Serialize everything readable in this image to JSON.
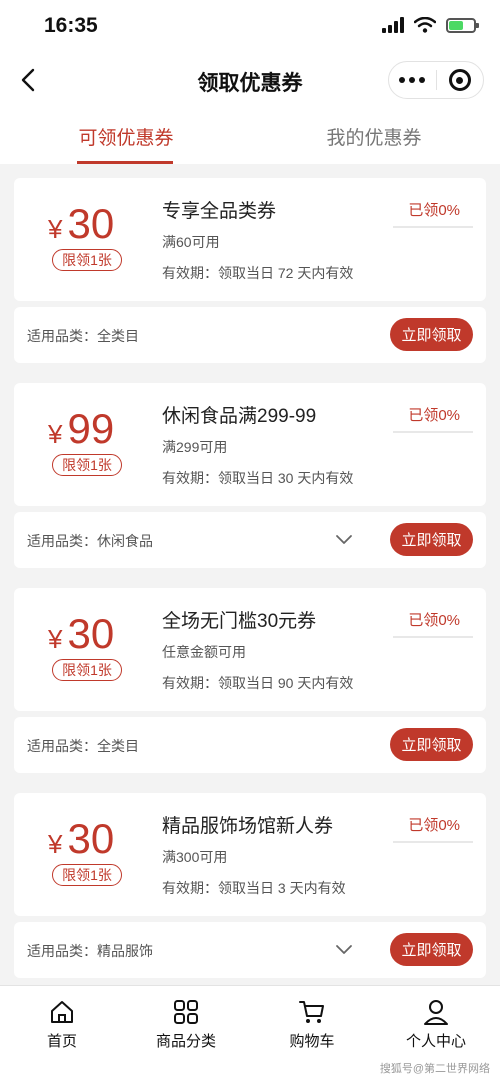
{
  "status_bar": {
    "time": "16:35"
  },
  "nav": {
    "title": "领取优惠券"
  },
  "tabs": [
    {
      "label": "可领优惠券",
      "active": true
    },
    {
      "label": "我的优惠券",
      "active": false
    }
  ],
  "coupons": [
    {
      "currency": "¥",
      "amount": "30",
      "limit": "限领1张",
      "title": "专享全品类券",
      "condition": "满60可用",
      "validity": "有效期：领取当日 72 天内有效",
      "claimed": "已领0%",
      "claimed_fraction": 0,
      "scope": "适用品类：全类目",
      "button": "立即领取",
      "expandable": false
    },
    {
      "currency": "¥",
      "amount": "99",
      "limit": "限领1张",
      "title": "休闲食品满299-99",
      "condition": "满299可用",
      "validity": "有效期：领取当日 30 天内有效",
      "claimed": "已领0%",
      "claimed_fraction": 0,
      "scope": "适用品类：休闲食品",
      "button": "立即领取",
      "expandable": true
    },
    {
      "currency": "¥",
      "amount": "30",
      "limit": "限领1张",
      "title": "全场无门槛30元券",
      "condition": "任意金额可用",
      "validity": "有效期：领取当日 90 天内有效",
      "claimed": "已领0%",
      "claimed_fraction": 0,
      "scope": "适用品类：全类目",
      "button": "立即领取",
      "expandable": false
    },
    {
      "currency": "¥",
      "amount": "30",
      "limit": "限领1张",
      "title": "精品服饰场馆新人券",
      "condition": "满300可用",
      "validity": "有效期：领取当日 3 天内有效",
      "claimed": "已领0%",
      "claimed_fraction": 0,
      "scope": "适用品类：精品服饰",
      "button": "立即领取",
      "expandable": true
    }
  ],
  "tab_bar": [
    {
      "label": "首页",
      "icon": "home-icon"
    },
    {
      "label": "商品分类",
      "icon": "category-grid-icon"
    },
    {
      "label": "购物车",
      "icon": "cart-icon"
    },
    {
      "label": "个人中心",
      "icon": "profile-icon"
    }
  ],
  "watermark": "搜狐号@第二世界网络",
  "colors": {
    "accent": "#c0392b",
    "background": "#f3f3f3",
    "battery": "#4cd964"
  }
}
